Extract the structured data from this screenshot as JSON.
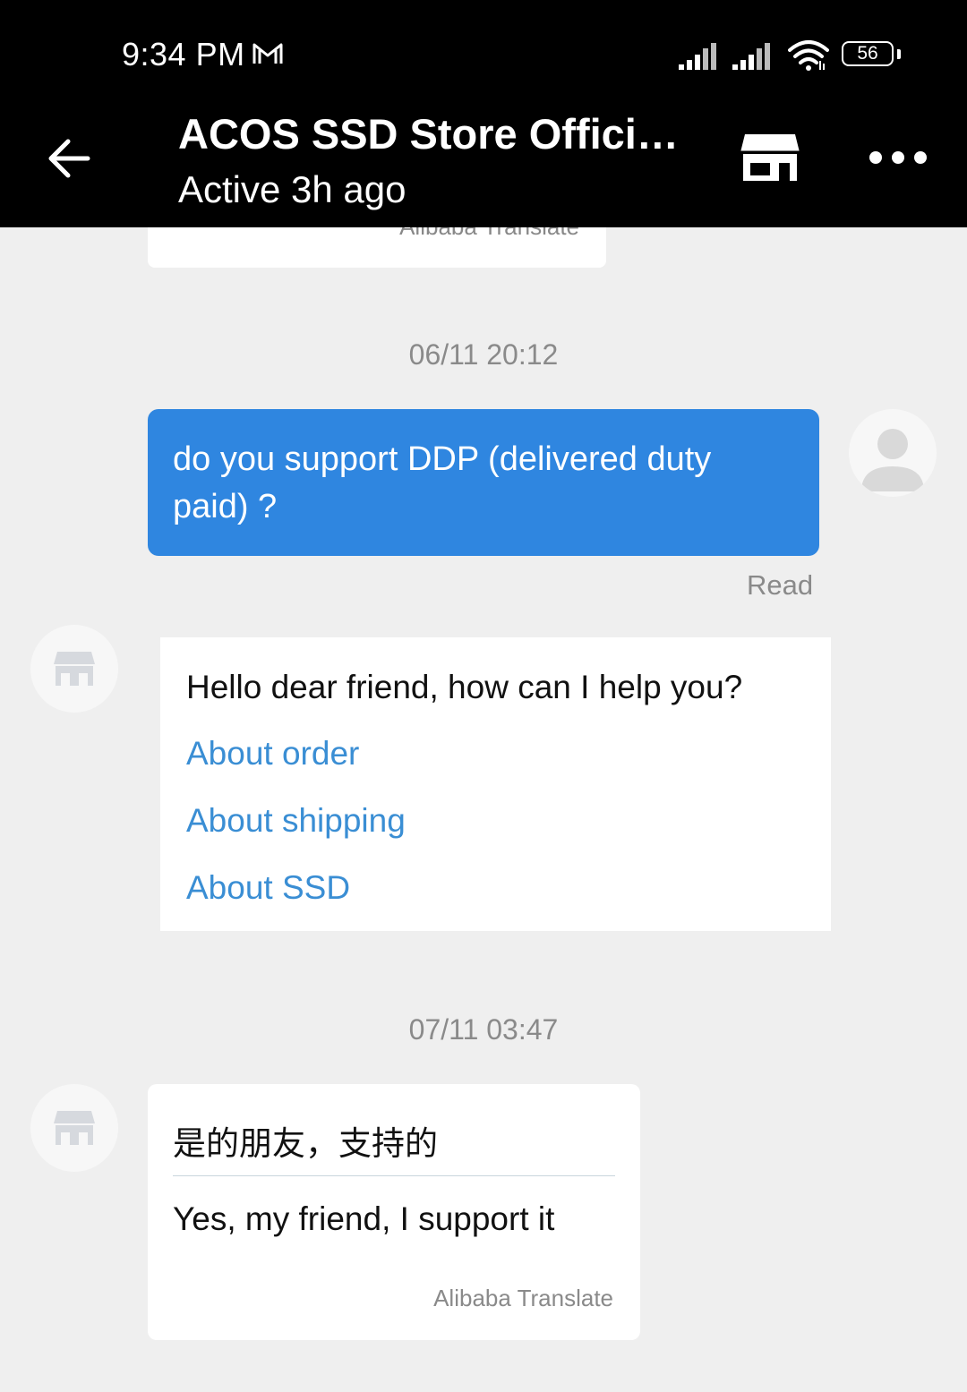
{
  "status_bar": {
    "time": "9:34 PM",
    "battery": "56"
  },
  "header": {
    "title": "ACOS SSD Store Official...",
    "subtitle": "Active 3h ago"
  },
  "messages": {
    "partial_credit": "Alibaba Translate",
    "timestamp_1": "06/11 20:12",
    "outgoing_text": "do you support DDP (delivered duty paid) ?",
    "read_status": "Read",
    "menu": {
      "greeting": "Hello dear friend, how can I help you?",
      "options": [
        "About order",
        "About shipping",
        "About SSD"
      ]
    },
    "timestamp_2": "07/11 03:47",
    "reply": {
      "original": "是的朋友，支持的",
      "translation": "Yes, my friend, I support it",
      "credit": "Alibaba Translate"
    }
  },
  "colors": {
    "outgoing_bubble": "#2f86e0",
    "link": "#3a8ed4",
    "background": "#efefef"
  }
}
